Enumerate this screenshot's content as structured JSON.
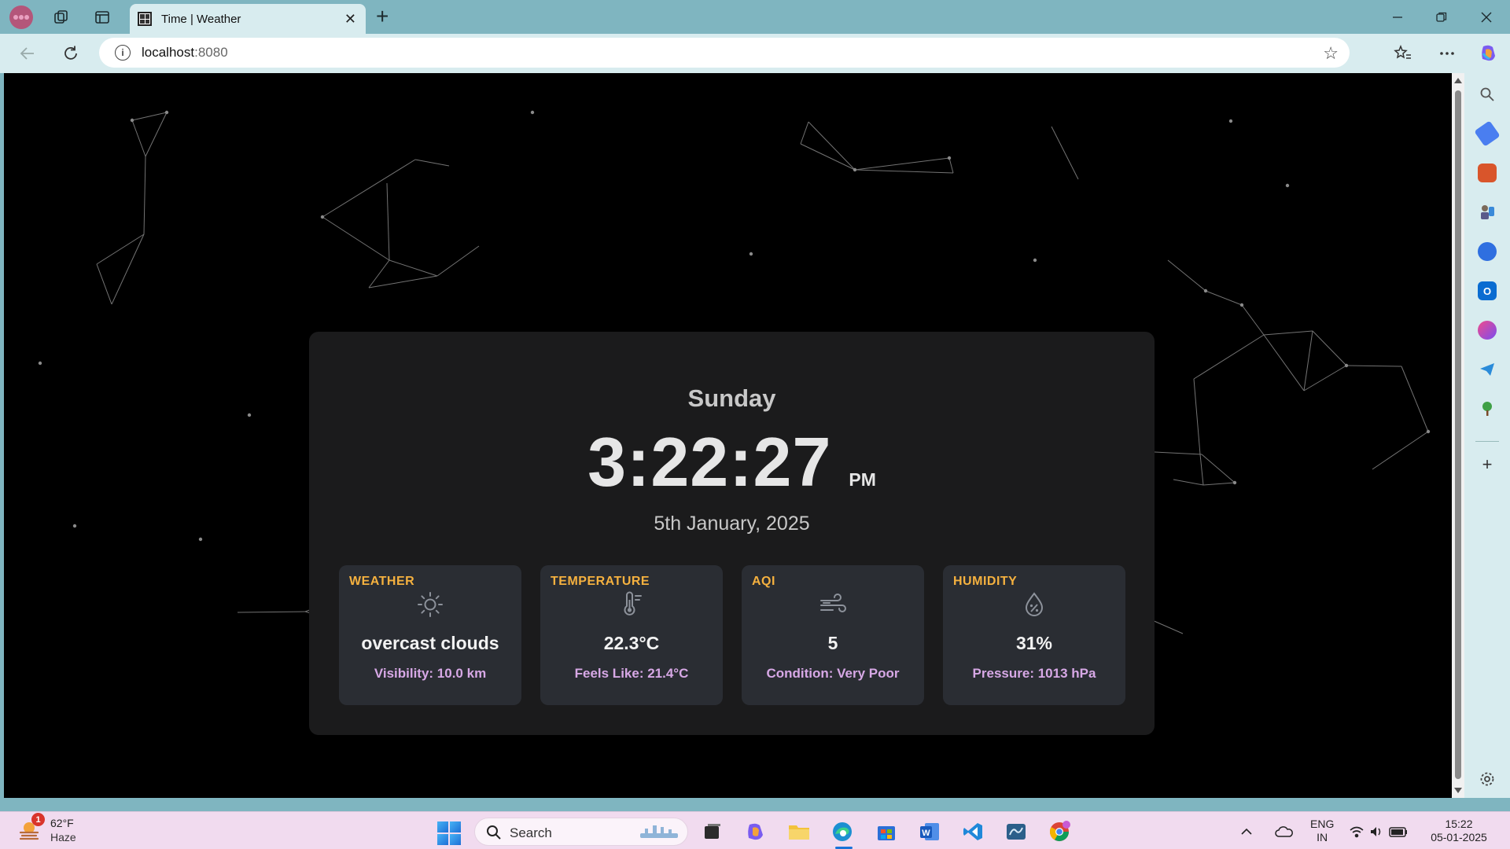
{
  "browser": {
    "tab_title": "Time | Weather",
    "url_host": "localhost",
    "url_port": ":8080"
  },
  "clock": {
    "day": "Sunday",
    "time": "3:22:27",
    "ampm": "PM",
    "date": "5th January, 2025"
  },
  "tiles": {
    "weather": {
      "label": "WEATHER",
      "value": "overcast clouds",
      "sub": "Visibility: 10.0 km",
      "icon": "sun-icon"
    },
    "temperature": {
      "label": "TEMPERATURE",
      "value": "22.3°C",
      "sub": "Feels Like: 21.4°C",
      "icon": "thermometer-icon"
    },
    "aqi": {
      "label": "AQI",
      "value": "5",
      "sub": "Condition: Very Poor",
      "icon": "wind-icon"
    },
    "humidity": {
      "label": "HUMIDITY",
      "value": "31%",
      "sub": "Pressure: 1013 hPa",
      "icon": "humidity-drop-icon"
    }
  },
  "colors": {
    "tile_label": "#f5b13f",
    "tile_sub": "#d7a8e6",
    "card_bg": "#1b1b1c",
    "tile_bg": "#2a2d33"
  },
  "taskbar": {
    "weather_temp": "62°F",
    "weather_cond": "Haze",
    "weather_badge": "1",
    "search_placeholder": "Search",
    "lang_top": "ENG",
    "lang_bottom": "IN",
    "time": "15:22",
    "date": "05-01-2025"
  }
}
